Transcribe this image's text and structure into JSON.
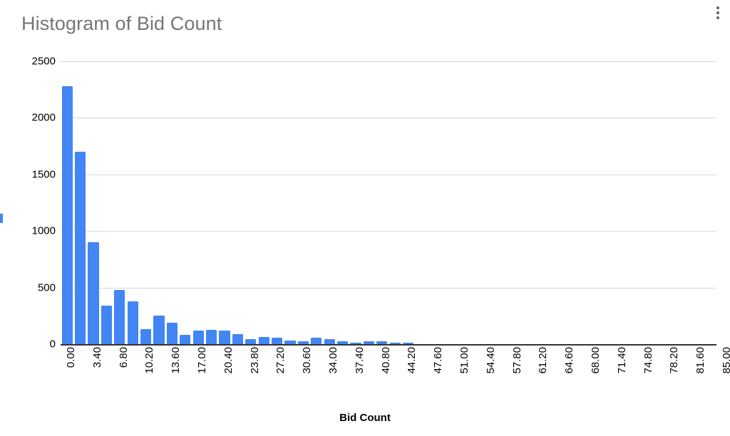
{
  "chart_data": {
    "type": "bar",
    "title": "Histogram of Bid Count",
    "xlabel": "Bid Count",
    "ylabel": "",
    "xlim": [
      0.0,
      85.0
    ],
    "ylim": [
      0,
      2500
    ],
    "grid": true,
    "legend": false,
    "bar_color": "#4285f4",
    "bin_width": 1.7,
    "x_tick_labels": [
      "0.00",
      "3.40",
      "6.80",
      "10.20",
      "13.60",
      "17.00",
      "20.40",
      "23.80",
      "27.20",
      "30.60",
      "34.00",
      "37.40",
      "40.80",
      "44.20",
      "47.60",
      "51.00",
      "54.40",
      "57.80",
      "61.20",
      "64.60",
      "68.00",
      "71.40",
      "74.80",
      "78.20",
      "81.60",
      "85.00"
    ],
    "x_tick_values": [
      0.0,
      3.4,
      6.8,
      10.2,
      13.6,
      17.0,
      20.4,
      23.8,
      27.2,
      30.6,
      34.0,
      37.4,
      40.8,
      44.2,
      47.6,
      51.0,
      54.4,
      57.8,
      61.2,
      64.6,
      68.0,
      71.4,
      74.8,
      78.2,
      81.6,
      85.0
    ],
    "y_tick_labels": [
      "0",
      "500",
      "1000",
      "1500",
      "2000",
      "2500"
    ],
    "y_tick_values": [
      0,
      500,
      1000,
      1500,
      2000,
      2500
    ],
    "bin_centers": [
      0.85,
      2.55,
      4.25,
      5.95,
      7.65,
      9.35,
      11.05,
      12.75,
      14.45,
      16.15,
      17.85,
      19.55,
      21.25,
      22.95,
      24.65,
      26.35,
      28.05,
      29.75,
      31.45,
      33.15,
      34.85,
      36.55,
      38.25,
      39.95,
      41.65,
      43.35,
      45.05,
      46.75,
      48.45,
      50.15,
      51.85,
      53.55,
      55.25,
      56.95,
      58.65,
      60.35,
      62.05,
      63.75,
      65.45,
      67.15,
      68.85,
      70.55,
      72.25,
      73.95,
      75.65,
      77.35,
      79.05,
      80.75,
      82.45,
      84.15
    ],
    "values": [
      2280,
      1700,
      900,
      340,
      480,
      380,
      135,
      255,
      190,
      85,
      120,
      125,
      120,
      90,
      45,
      65,
      55,
      30,
      25,
      55,
      45,
      25,
      10,
      25,
      25,
      10,
      10,
      0,
      0,
      0,
      0,
      0,
      0,
      0,
      0,
      0,
      0,
      0,
      0,
      0,
      0,
      0,
      0,
      0,
      0,
      0,
      0,
      0,
      0,
      0
    ]
  },
  "header": {
    "title": "Histogram of Bid Count",
    "menu_icon": "kebab-menu-icon"
  },
  "axis": {
    "x_title": "Bid Count"
  }
}
